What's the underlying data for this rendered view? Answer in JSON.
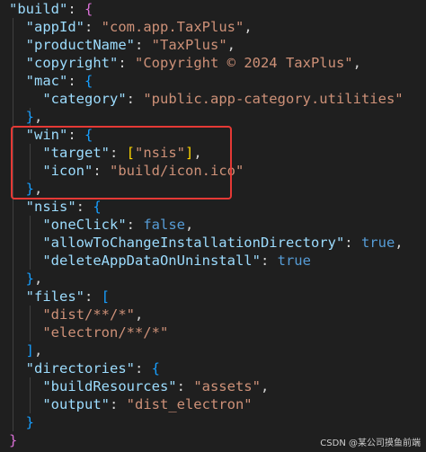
{
  "code": {
    "build_key": "\"build\"",
    "app_id_key": "\"appId\"",
    "app_id_val": "\"com.app.TaxPlus\"",
    "product_key": "\"productName\"",
    "product_val": "\"TaxPlus\"",
    "copyright_key": "\"copyright\"",
    "copyright_val": "\"Copyright © 2024 TaxPlus\"",
    "mac_key": "\"mac\"",
    "category_key": "\"category\"",
    "category_val": "\"public.app-category.utilities\"",
    "win_key": "\"win\"",
    "target_key": "\"target\"",
    "target_val": "\"nsis\"",
    "icon_key": "\"icon\"",
    "icon_val": "\"build/icon.ico\"",
    "nsis_key": "\"nsis\"",
    "oneclick_key": "\"oneClick\"",
    "oneclick_val": "false",
    "allow_key": "\"allowToChangeInstallationDirectory\"",
    "allow_val": "true",
    "delete_key": "\"deleteAppDataOnUninstall\"",
    "delete_val": "true",
    "files_key": "\"files\"",
    "files_item1": "\"dist/**/*\"",
    "files_item2": "\"electron/**/*\"",
    "directories_key": "\"directories\"",
    "build_res_key": "\"buildResources\"",
    "build_res_val": "\"assets\"",
    "output_key": "\"output\"",
    "output_val": "\"dist_electron\""
  },
  "colors": {
    "background": "#1f1f1f",
    "key": "#9cdcfe",
    "string": "#ce9178",
    "keyword": "#569cd6",
    "highlight_border": "#e53935"
  },
  "watermark": "CSDN @某公司摸鱼前端"
}
